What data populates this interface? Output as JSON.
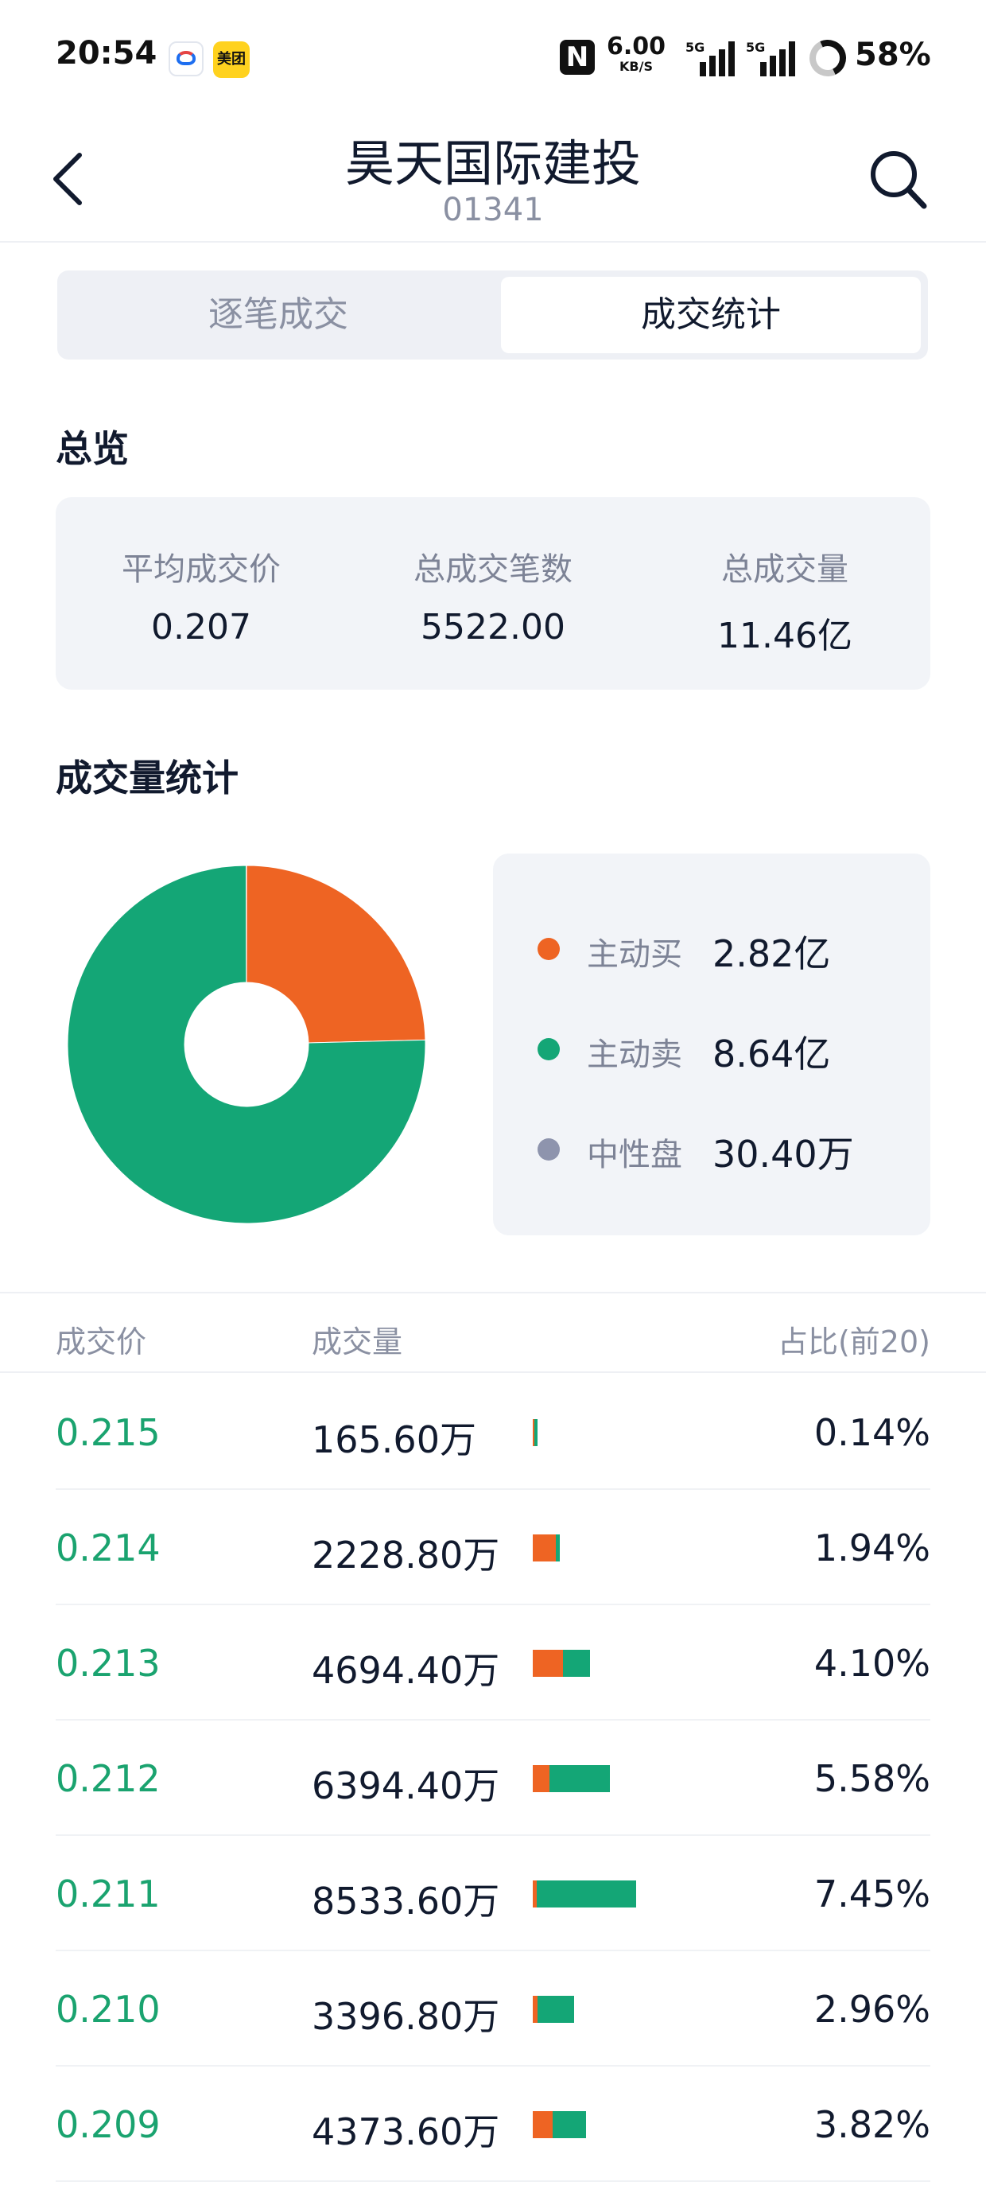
{
  "status_bar": {
    "time": "20:54",
    "app_icons": [
      "map-app-icon",
      "meituan-app-icon"
    ],
    "meituan_label": "美团",
    "nfc_label": "N",
    "net_speed_value": "6.00",
    "net_speed_unit": "KB/S",
    "signal_1_tag": "5G",
    "signal_2_tag": "5G",
    "battery_percent": "58%"
  },
  "header": {
    "title": "昊天国际建投",
    "code": "01341",
    "back_icon": "chevron-left-icon",
    "search_icon": "search-icon"
  },
  "tabs": [
    {
      "label": "逐笔成交",
      "active": false
    },
    {
      "label": "成交统计",
      "active": true
    }
  ],
  "overview": {
    "title": "总览",
    "items": [
      {
        "label": "平均成交价",
        "value": "0.207"
      },
      {
        "label": "总成交笔数",
        "value": "5522.00"
      },
      {
        "label": "总成交量",
        "value": "11.46亿"
      }
    ]
  },
  "volume_stats": {
    "title": "成交量统计",
    "legend": [
      {
        "label": "主动买",
        "value": "2.82亿",
        "color": "#ee6423"
      },
      {
        "label": "主动卖",
        "value": "8.64亿",
        "color": "#14a676"
      },
      {
        "label": "中性盘",
        "value": "30.40万",
        "color": "#8e94ad"
      }
    ]
  },
  "chart_data": {
    "type": "pie",
    "donut": true,
    "categories": [
      "主动买",
      "主动卖",
      "中性盘"
    ],
    "values": [
      2.82,
      8.64,
      0.00304
    ],
    "unit": "亿",
    "colors": [
      "#ee6423",
      "#14a676",
      "#8e94ad"
    ]
  },
  "table": {
    "headers": {
      "price": "成交价",
      "volume": "成交量",
      "pct": "占比(前20)"
    },
    "rows": [
      {
        "price": "0.215",
        "volume": "165.60万",
        "pct": "0.14%",
        "buy_share": 0.3,
        "sell_share": 0.7
      },
      {
        "price": "0.214",
        "volume": "2228.80万",
        "pct": "1.94%",
        "buy_share": 0.85,
        "sell_share": 0.15
      },
      {
        "price": "0.213",
        "volume": "4694.40万",
        "pct": "4.10%",
        "buy_share": 0.53,
        "sell_share": 0.47
      },
      {
        "price": "0.212",
        "volume": "6394.40万",
        "pct": "5.58%",
        "buy_share": 0.22,
        "sell_share": 0.78
      },
      {
        "price": "0.211",
        "volume": "8533.60万",
        "pct": "7.45%",
        "buy_share": 0.04,
        "sell_share": 0.96
      },
      {
        "price": "0.210",
        "volume": "3396.80万",
        "pct": "2.96%",
        "buy_share": 0.12,
        "sell_share": 0.88
      },
      {
        "price": "0.209",
        "volume": "4373.60万",
        "pct": "3.82%",
        "buy_share": 0.38,
        "sell_share": 0.62
      }
    ]
  }
}
